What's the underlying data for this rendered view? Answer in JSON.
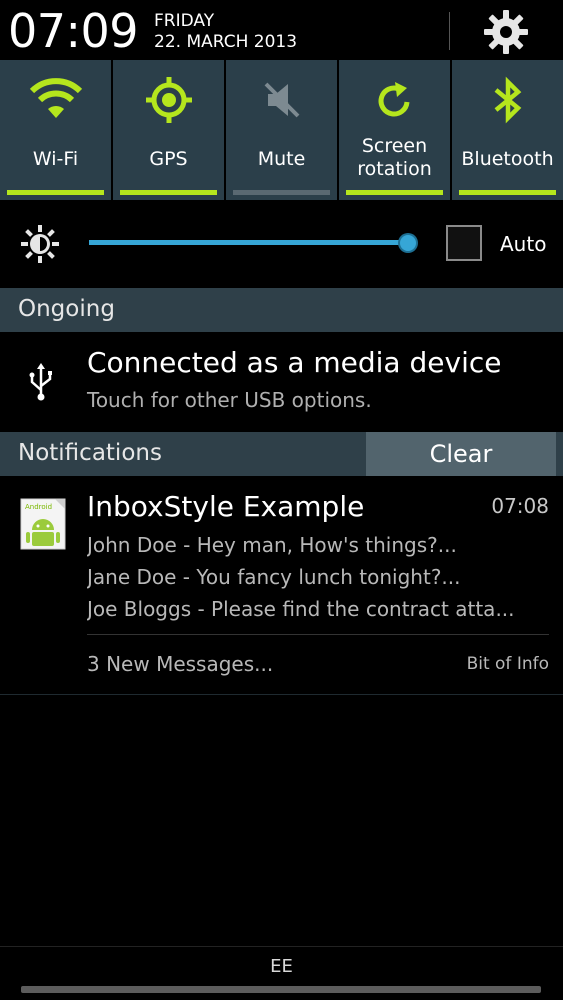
{
  "status": {
    "clock": "07:09",
    "day": "FRIDAY",
    "date": "22. MARCH 2013"
  },
  "toggles": [
    {
      "label": "Wi-Fi",
      "icon": "wifi-icon",
      "state": "on"
    },
    {
      "label": "GPS",
      "icon": "gps-icon",
      "state": "on"
    },
    {
      "label": "Mute",
      "icon": "mute-icon",
      "state": "off"
    },
    {
      "label_line1": "Screen",
      "label_line2": "rotation",
      "icon": "screen-rotation-icon",
      "state": "on"
    },
    {
      "label": "Bluetooth",
      "icon": "bluetooth-icon",
      "state": "on"
    }
  ],
  "brightness": {
    "auto_label": "Auto",
    "level": 0.94,
    "auto_checked": false
  },
  "ongoing": {
    "header": "Ongoing",
    "title": "Connected as a media device",
    "subtitle": "Touch for other USB options."
  },
  "notifications": {
    "header": "Notifications",
    "clear_label": "Clear",
    "items": [
      {
        "title": "InboxStyle Example",
        "time": "07:08",
        "icon_text": "Android",
        "lines": [
          "John Doe - Hey man, How's things?...",
          "Jane Doe - You fancy lunch tonight?...",
          "Joe Bloggs - Please find the contract atta..."
        ],
        "summary": "3 New Messages...",
        "info": "Bit of Info"
      }
    ]
  },
  "footer": {
    "carrier": "EE"
  },
  "colors": {
    "accent_green": "#b5e61d",
    "slider_blue": "#36a6d6",
    "panel": "#2b3f4a"
  }
}
